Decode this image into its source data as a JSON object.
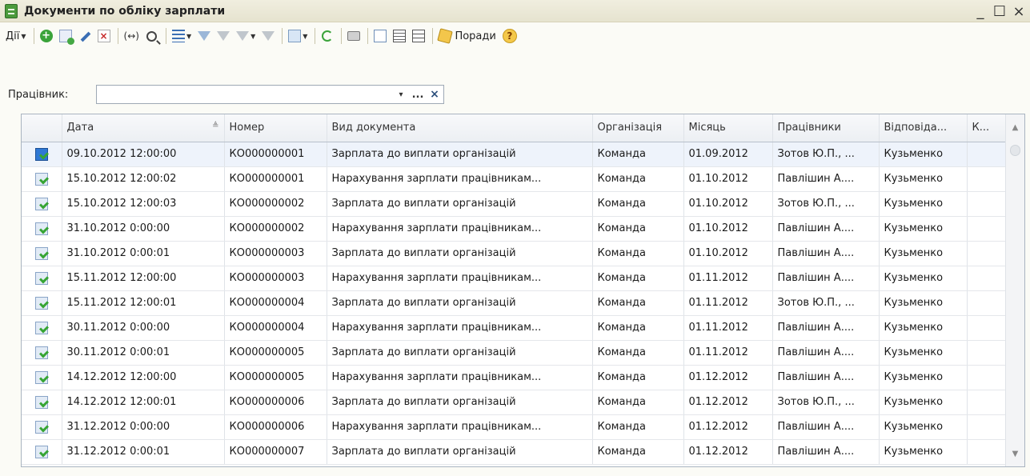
{
  "window": {
    "title": "Документи по обліку зарплати",
    "controls": {
      "minimize": "_",
      "maximize": "☐",
      "close": "×"
    }
  },
  "toolbar": {
    "actions_label": "Дії",
    "tips_label": "Поради",
    "help_label": "?",
    "pair_label": "(↔)"
  },
  "filter": {
    "label": "Працівник:",
    "value": "",
    "dots": "...",
    "clear": "×",
    "dropdown": "▾"
  },
  "table": {
    "columns": [
      "",
      "Дата",
      "Номер",
      "Вид документа",
      "Організація",
      "Місяць",
      "Працівники",
      "Відповіда...",
      "К..."
    ],
    "rows": [
      {
        "date": "09.10.2012 12:00:00",
        "number": "КО000000001",
        "type": "Зарплата до виплати організацій",
        "org": "Команда",
        "month": "01.09.2012",
        "workers": "Зотов Ю.П., ...",
        "resp": "Кузьменко",
        "k": ""
      },
      {
        "date": "15.10.2012 12:00:02",
        "number": "КО000000001",
        "type": "Нарахування зарплати працівникам...",
        "org": "Команда",
        "month": "01.10.2012",
        "workers": "Павлішин А....",
        "resp": "Кузьменко",
        "k": ""
      },
      {
        "date": "15.10.2012 12:00:03",
        "number": "КО000000002",
        "type": "Зарплата до виплати організацій",
        "org": "Команда",
        "month": "01.10.2012",
        "workers": "Зотов Ю.П., ...",
        "resp": "Кузьменко",
        "k": ""
      },
      {
        "date": "31.10.2012 0:00:00",
        "number": "КО000000002",
        "type": "Нарахування зарплати працівникам...",
        "org": "Команда",
        "month": "01.10.2012",
        "workers": "Павлішин А....",
        "resp": "Кузьменко",
        "k": ""
      },
      {
        "date": "31.10.2012 0:00:01",
        "number": "КО000000003",
        "type": "Зарплата до виплати організацій",
        "org": "Команда",
        "month": "01.10.2012",
        "workers": "Павлішин А....",
        "resp": "Кузьменко",
        "k": ""
      },
      {
        "date": "15.11.2012 12:00:00",
        "number": "КО000000003",
        "type": "Нарахування зарплати працівникам...",
        "org": "Команда",
        "month": "01.11.2012",
        "workers": "Павлішин А....",
        "resp": "Кузьменко",
        "k": ""
      },
      {
        "date": "15.11.2012 12:00:01",
        "number": "КО000000004",
        "type": "Зарплата до виплати організацій",
        "org": "Команда",
        "month": "01.11.2012",
        "workers": "Зотов Ю.П., ...",
        "resp": "Кузьменко",
        "k": ""
      },
      {
        "date": "30.11.2012 0:00:00",
        "number": "КО000000004",
        "type": "Нарахування зарплати працівникам...",
        "org": "Команда",
        "month": "01.11.2012",
        "workers": "Павлішин А....",
        "resp": "Кузьменко",
        "k": ""
      },
      {
        "date": "30.11.2012 0:00:01",
        "number": "КО000000005",
        "type": "Зарплата до виплати організацій",
        "org": "Команда",
        "month": "01.11.2012",
        "workers": "Павлішин А....",
        "resp": "Кузьменко",
        "k": ""
      },
      {
        "date": "14.12.2012 12:00:00",
        "number": "КО000000005",
        "type": "Нарахування зарплати працівникам...",
        "org": "Команда",
        "month": "01.12.2012",
        "workers": "Павлішин А....",
        "resp": "Кузьменко",
        "k": ""
      },
      {
        "date": "14.12.2012 12:00:01",
        "number": "КО000000006",
        "type": "Зарплата до виплати організацій",
        "org": "Команда",
        "month": "01.12.2012",
        "workers": "Зотов Ю.П., ...",
        "resp": "Кузьменко",
        "k": ""
      },
      {
        "date": "31.12.2012 0:00:00",
        "number": "КО000000006",
        "type": "Нарахування зарплати працівникам...",
        "org": "Команда",
        "month": "01.12.2012",
        "workers": "Павлішин А....",
        "resp": "Кузьменко",
        "k": ""
      },
      {
        "date": "31.12.2012 0:00:01",
        "number": "КО000000007",
        "type": "Зарплата до виплати організацій",
        "org": "Команда",
        "month": "01.12.2012",
        "workers": "Павлішин А....",
        "resp": "Кузьменко",
        "k": ""
      }
    ],
    "selected_row": 0,
    "sort_column": "Дата",
    "sort_indicator": "≜"
  },
  "colors": {
    "accent": "#2f78d4",
    "title_bar": "#e6e3cf",
    "check": "#37a534"
  }
}
